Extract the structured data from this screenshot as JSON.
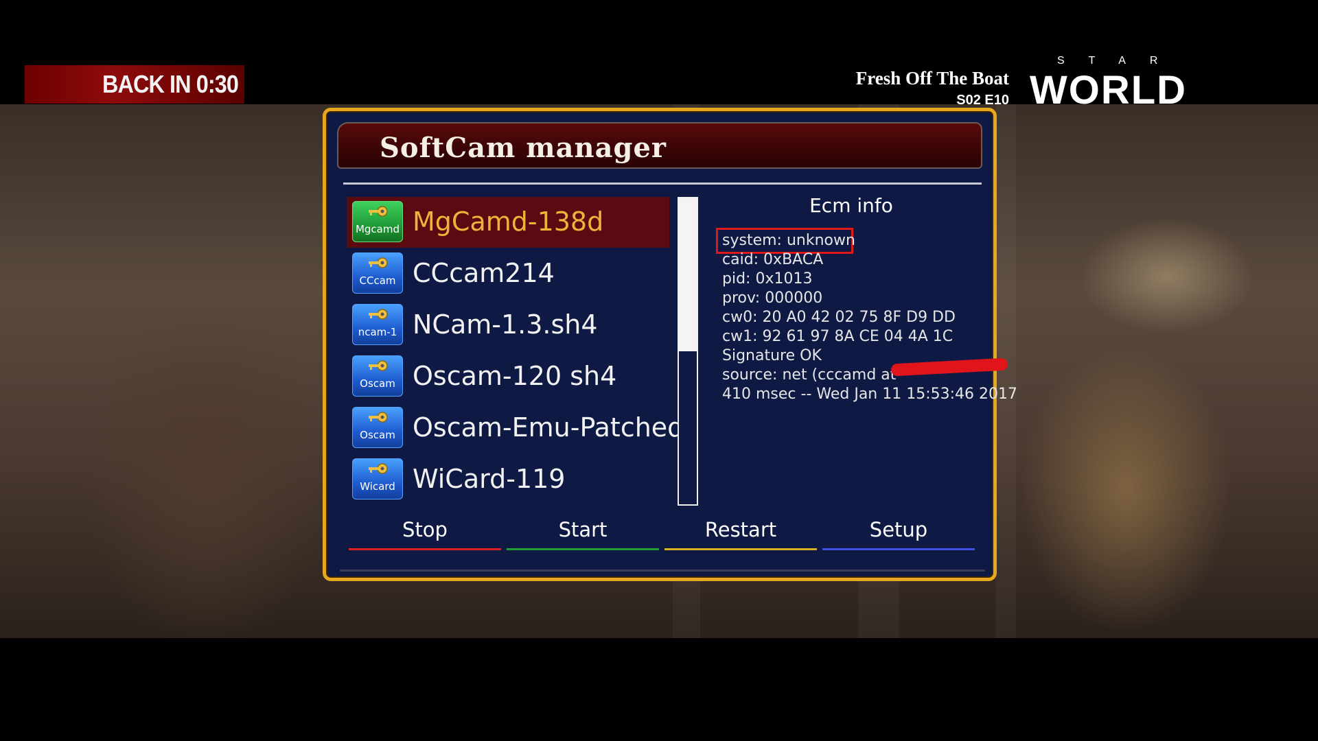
{
  "overlay": {
    "back_in": "BACK IN  0:30",
    "show_title": "Fresh Off The Boat",
    "show_episode": "S02 E10",
    "channel_top": "STAR",
    "channel_word": "WORLD"
  },
  "dialog": {
    "title": "SoftCam manager",
    "cams": [
      {
        "name": "MgCamd-138d",
        "icon_label": "Mgcamd",
        "icon_color": "#2fbf4a",
        "icon": "key-icon"
      },
      {
        "name": "CCcam214",
        "icon_label": "CCcam",
        "icon_color": "#2a6fe0",
        "icon": "key-icon"
      },
      {
        "name": "NCam-1.3.sh4",
        "icon_label": "ncam-1",
        "icon_color": "#2a6fe0",
        "icon": "key-icon"
      },
      {
        "name": "Oscam-120 sh4",
        "icon_label": "Oscam",
        "icon_color": "#2a6fe0",
        "icon": "key-icon"
      },
      {
        "name": "Oscam-Emu-Patched",
        "icon_label": "Oscam",
        "icon_color": "#2a6fe0",
        "icon": "key-icon"
      },
      {
        "name": "WiCard-119",
        "icon_label": "Wicard",
        "icon_color": "#2a6fe0",
        "icon": "key-icon"
      }
    ],
    "scroll_fraction": 0.5,
    "ecm": {
      "title": "Ecm info",
      "lines": [
        "system: unknown",
        "caid: 0xBACA",
        "pid: 0x1013",
        "prov: 000000",
        "cw0: 20 A0 42 02 75 8F D9 DD",
        "cw1: 92 61 97 8A CE 04 4A 1C",
        "Signature OK",
        "source: net (cccamd at",
        "410 msec -- Wed Jan 11 15:53:46 2017"
      ]
    },
    "buttons": [
      {
        "label": "Stop",
        "color": "#e02020"
      },
      {
        "label": "Start",
        "color": "#20a030"
      },
      {
        "label": "Restart",
        "color": "#d8b020"
      },
      {
        "label": "Setup",
        "color": "#4050e0"
      }
    ],
    "colors": {
      "frame": "#e6a81e",
      "background": "#0f1a44",
      "selected_row": "#5a0a10",
      "selected_text": "#f0b23a"
    }
  }
}
